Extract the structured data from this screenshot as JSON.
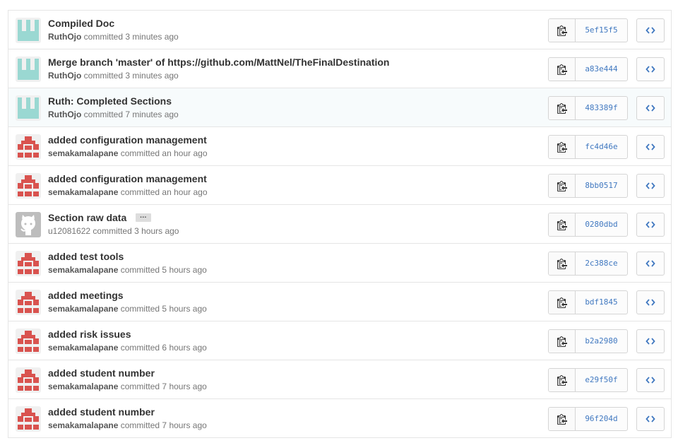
{
  "commits": [
    {
      "message": "Compiled Doc",
      "author": "RuthOjo",
      "time": "committed 3 minutes ago",
      "sha": "5ef15f5",
      "avatar": "teal-identicon",
      "author_bold": true,
      "highlight": false,
      "has_ellipsis": false
    },
    {
      "message": "Merge branch 'master' of https://github.com/MattNel/TheFinalDestination",
      "author": "RuthOjo",
      "time": "committed 3 minutes ago",
      "sha": "a83e444",
      "avatar": "teal-identicon",
      "author_bold": true,
      "highlight": false,
      "has_ellipsis": false
    },
    {
      "message": "Ruth: Completed Sections",
      "author": "RuthOjo",
      "time": "committed 7 minutes ago",
      "sha": "483389f",
      "avatar": "teal-identicon",
      "author_bold": true,
      "highlight": true,
      "has_ellipsis": false
    },
    {
      "message": "added configuration management",
      "author": "semakamalapane",
      "time": "committed an hour ago",
      "sha": "fc4d46e",
      "avatar": "red-identicon",
      "author_bold": true,
      "highlight": false,
      "has_ellipsis": false
    },
    {
      "message": "added configuration management",
      "author": "semakamalapane",
      "time": "committed an hour ago",
      "sha": "8bb0517",
      "avatar": "red-identicon",
      "author_bold": true,
      "highlight": false,
      "has_ellipsis": false
    },
    {
      "message": "Section raw data",
      "author": "u12081622",
      "time": "committed 3 hours ago",
      "sha": "0280dbd",
      "avatar": "octocat-default",
      "author_bold": false,
      "highlight": false,
      "has_ellipsis": true,
      "ellipsis_label": "…"
    },
    {
      "message": "added test tools",
      "author": "semakamalapane",
      "time": "committed 5 hours ago",
      "sha": "2c388ce",
      "avatar": "red-identicon",
      "author_bold": true,
      "highlight": false,
      "has_ellipsis": false
    },
    {
      "message": "added meetings",
      "author": "semakamalapane",
      "time": "committed 5 hours ago",
      "sha": "bdf1845",
      "avatar": "red-identicon",
      "author_bold": true,
      "highlight": false,
      "has_ellipsis": false
    },
    {
      "message": "added risk issues",
      "author": "semakamalapane",
      "time": "committed 6 hours ago",
      "sha": "b2a2980",
      "avatar": "red-identicon",
      "author_bold": true,
      "highlight": false,
      "has_ellipsis": false
    },
    {
      "message": "added student number",
      "author": "semakamalapane",
      "time": "committed 7 hours ago",
      "sha": "e29f50f",
      "avatar": "red-identicon",
      "author_bold": true,
      "highlight": false,
      "has_ellipsis": false
    },
    {
      "message": "added student number",
      "author": "semakamalapane",
      "time": "committed 7 hours ago",
      "sha": "96f204d",
      "avatar": "red-identicon",
      "author_bold": true,
      "highlight": false,
      "has_ellipsis": false
    }
  ],
  "icons": {
    "copy": "clippy-icon",
    "browse": "code-icon"
  },
  "colors": {
    "teal": "#9ad8d2",
    "red": "#d9534f",
    "link": "#4078c0",
    "meta": "#767676"
  }
}
